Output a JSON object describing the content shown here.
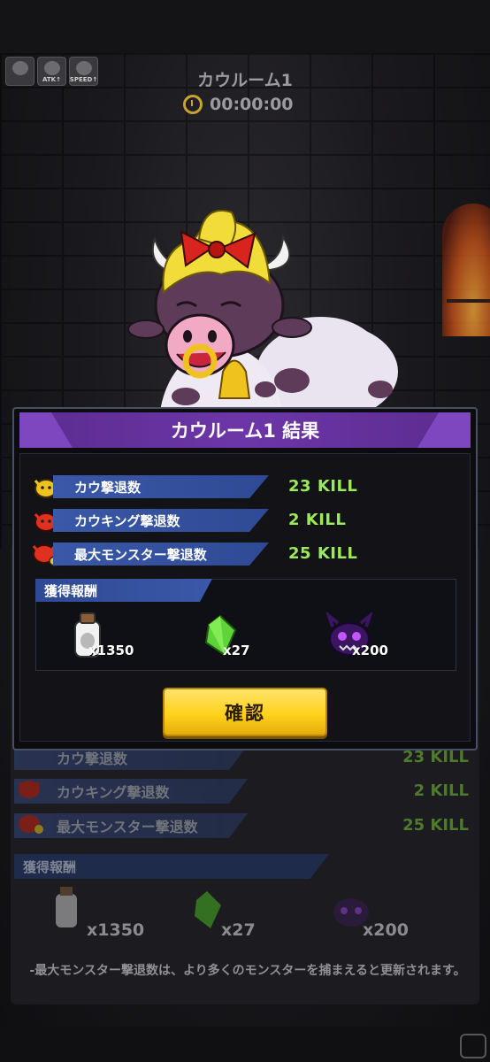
{
  "room": {
    "title": "カウルーム1",
    "timer": "00:00:00"
  },
  "buffs": [
    {
      "label": "",
      "icon": "character-buff-icon"
    },
    {
      "label": "ATK↑",
      "icon": "sword-buff-icon"
    },
    {
      "label": "SPEED↑",
      "icon": "speed-buff-icon"
    }
  ],
  "modal": {
    "title": "カウルーム1 結果",
    "stats": [
      {
        "label": "カウ撃退数",
        "value": "23 KILL",
        "icon": "cow-yellow-icon"
      },
      {
        "label": "カウキング撃退数",
        "value": "2 KILL",
        "icon": "cow-king-red-icon"
      },
      {
        "label": "最大モンスター撃退数",
        "value": "25 KILL",
        "icon": "max-monster-icon"
      }
    ],
    "rewards_label": "獲得報酬",
    "rewards": [
      {
        "amount": "x1350",
        "icon": "milk-bottle-icon"
      },
      {
        "amount": "x27",
        "icon": "green-crystal-icon"
      },
      {
        "amount": "x200",
        "icon": "purple-monster-icon"
      }
    ],
    "confirm_label": "確認"
  },
  "background_panel": {
    "stats": [
      {
        "label": "カウ撃退数",
        "value": "23 KILL"
      },
      {
        "label": "カウキング撃退数",
        "value": "2 KILL"
      },
      {
        "label": "最大モンスター撃退数",
        "value": "25 KILL"
      }
    ],
    "rewards_label": "獲得報酬",
    "rewards": [
      "x1350",
      "x27",
      "x200"
    ],
    "note": "-最大モンスター撃退数は、より多くのモンスターを捕まえると更新されます。"
  },
  "colors": {
    "kill_green": "#9bea5a",
    "header_purple": "#6d36a8",
    "label_blue": "#3a58a8",
    "confirm_yellow": "#ffd21c"
  }
}
